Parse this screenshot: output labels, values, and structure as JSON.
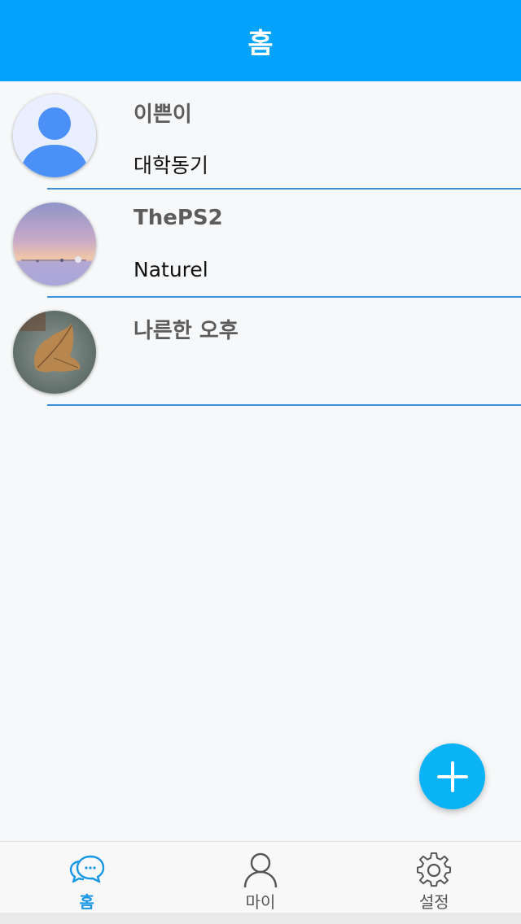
{
  "header": {
    "title": "홈"
  },
  "contacts": [
    {
      "name": "이쁜이",
      "subtitle": "대학동기",
      "avatar": "default-user-avatar"
    },
    {
      "name": "ThePS2",
      "subtitle": "Naturel",
      "avatar": "seascape-photo-avatar"
    },
    {
      "name": "나른한 오후",
      "subtitle": "",
      "avatar": "dry-leaf-photo-avatar"
    }
  ],
  "fab": {
    "icon": "plus-icon"
  },
  "tabbar": {
    "tabs": [
      {
        "label": "홈",
        "icon": "chat-bubbles-icon",
        "active": true
      },
      {
        "label": "마이",
        "icon": "person-icon",
        "active": false
      },
      {
        "label": "설정",
        "icon": "gear-icon",
        "active": false
      }
    ]
  },
  "colors": {
    "header": "#04a3fb",
    "fab": "#0ab3f5",
    "divider": "#3a8fd6",
    "active_tab": "#1a96e6"
  }
}
